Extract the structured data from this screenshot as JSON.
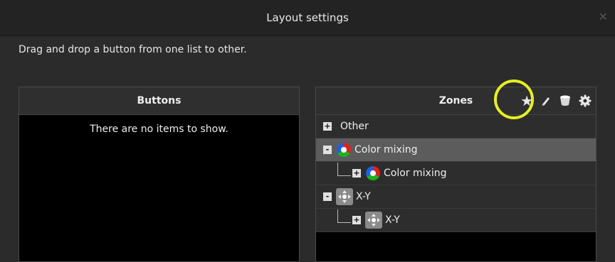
{
  "window": {
    "title": "Layout settings"
  },
  "instruction": "Drag and drop a button from one list to other.",
  "buttons_panel": {
    "title": "Buttons",
    "empty_message": "There are no items to show."
  },
  "zones_panel": {
    "title": "Zones",
    "icons": [
      "star-icon",
      "pencil-icon",
      "bucket-icon",
      "gear-icon"
    ],
    "tree": [
      {
        "label": "Other",
        "expander": "+",
        "icon": "none"
      },
      {
        "label": "Color mixing",
        "expander": "-",
        "icon": "rgb-icon",
        "selected": true
      },
      {
        "label": "Color mixing",
        "expander": "+",
        "icon": "rgb-icon",
        "child": true
      },
      {
        "label": "X-Y",
        "expander": "-",
        "icon": "xy-icon"
      },
      {
        "label": "X-Y",
        "expander": "+",
        "icon": "xy-icon",
        "child": true
      }
    ]
  },
  "colors": {
    "highlight": "#e6f021",
    "selected_row": "#5c5c5c"
  }
}
